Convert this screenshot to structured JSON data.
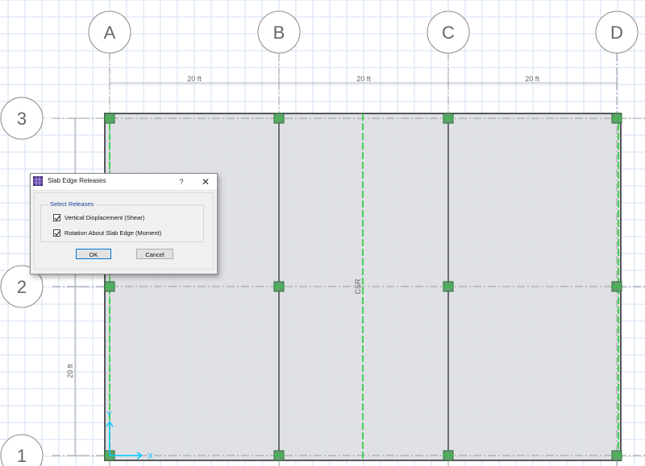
{
  "grid": {
    "columns": [
      "A",
      "B",
      "C",
      "D"
    ],
    "rows": [
      "3",
      "2",
      "1"
    ],
    "spacing_labels": {
      "a_b": "20 ft",
      "b_c": "20 ft",
      "c_d": "20 ft",
      "row_1_2": "20 ft"
    }
  },
  "strip_label": "CSR",
  "axes": {
    "x_label": "X",
    "y_label": "Y"
  },
  "colors": {
    "slab_fill": "#dfe1e5",
    "grid_blue": "#c8d8f0",
    "release_green": "#22cc33",
    "axis_cyan": "#00c8ff"
  },
  "dialog": {
    "title": "Slab Edge Releases",
    "help_label": "?",
    "close_label": "✕",
    "group_label": "Select Releases",
    "options": [
      {
        "label": "Vertical Displacement (Shear)",
        "checked": true
      },
      {
        "label": "Rotation About Slab Edge (Moment)",
        "checked": true
      }
    ],
    "ok_label": "OK",
    "cancel_label": "Cancel"
  }
}
